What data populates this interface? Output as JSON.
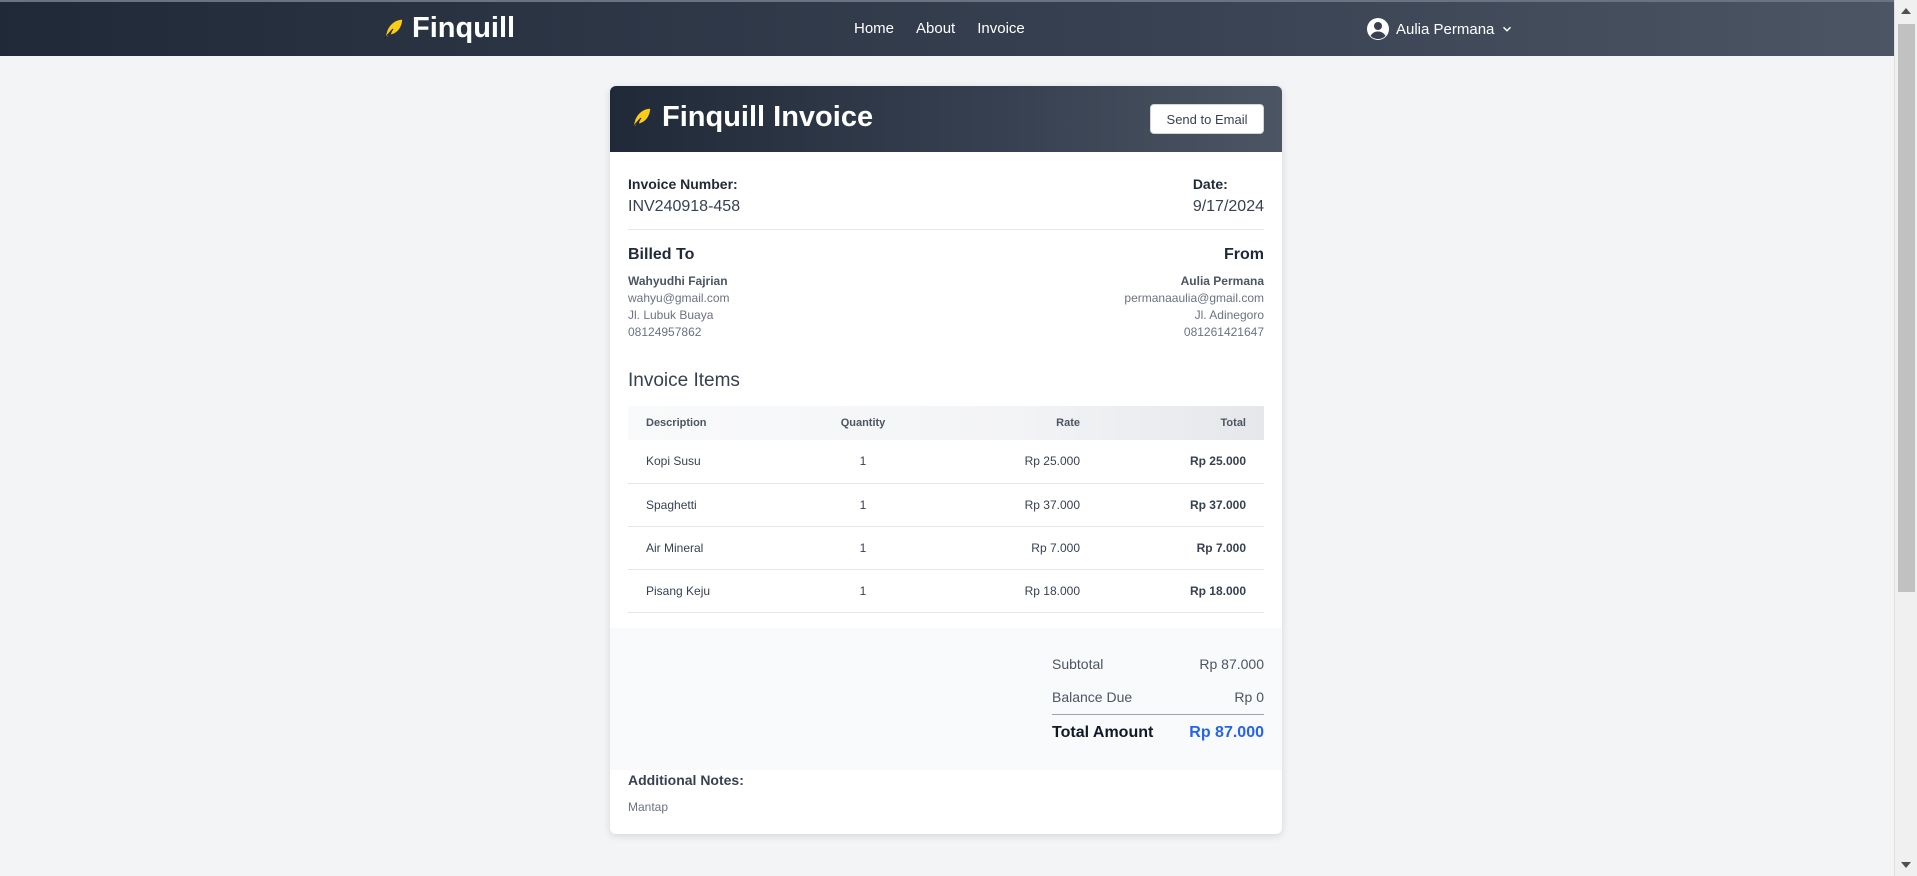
{
  "nav": {
    "brand": "Finquill",
    "links": [
      "Home",
      "About",
      "Invoice"
    ],
    "user_name": "Aulia Permana"
  },
  "invoice": {
    "title": "Finquill Invoice",
    "send_button": "Send to Email",
    "number_label": "Invoice Number:",
    "number": "INV240918-458",
    "date_label": "Date:",
    "date": "9/17/2024",
    "billed_to": {
      "heading": "Billed To",
      "name": "Wahyudhi Fajrian",
      "email": "wahyu@gmail.com",
      "address": "Jl. Lubuk Buaya",
      "phone": "08124957862"
    },
    "from": {
      "heading": "From",
      "name": "Aulia Permana",
      "email": "permanaaulia@gmail.com",
      "address": "Jl. Adinegoro",
      "phone": "081261421647"
    },
    "items_title": "Invoice Items",
    "columns": [
      "Description",
      "Quantity",
      "Rate",
      "Total"
    ],
    "items": [
      {
        "description": "Kopi Susu",
        "quantity": "1",
        "rate": "Rp 25.000",
        "total": "Rp 25.000"
      },
      {
        "description": "Spaghetti",
        "quantity": "1",
        "rate": "Rp 37.000",
        "total": "Rp 37.000"
      },
      {
        "description": "Air Mineral",
        "quantity": "1",
        "rate": "Rp 7.000",
        "total": "Rp 7.000"
      },
      {
        "description": "Pisang Keju",
        "quantity": "1",
        "rate": "Rp 18.000",
        "total": "Rp 18.000"
      }
    ],
    "subtotal_label": "Subtotal",
    "subtotal": "Rp 87.000",
    "balance_label": "Balance Due",
    "balance": "Rp 0",
    "total_label": "Total Amount",
    "total": "Rp 87.000",
    "notes_label": "Additional Notes:",
    "notes": "Mantap"
  },
  "colors": {
    "header_dark": "#1f2937",
    "accent_yellow": "#facc15",
    "total_blue": "#2563eb"
  },
  "icons": [
    "feather-icon",
    "user-circle-icon",
    "chevron-down-icon"
  ]
}
